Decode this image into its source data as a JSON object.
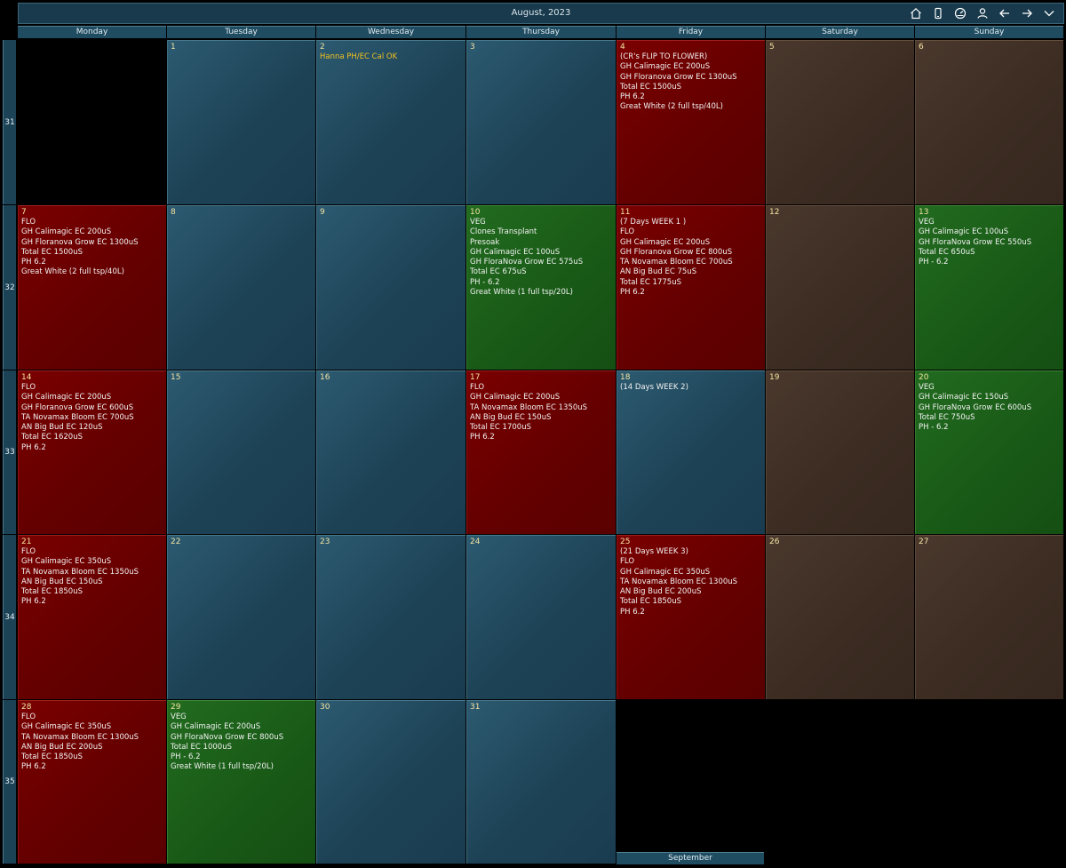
{
  "header": {
    "title": "August, 2023",
    "tools": [
      {
        "name": "home-icon"
      },
      {
        "name": "phone-icon"
      },
      {
        "name": "gauge-icon"
      },
      {
        "name": "user-icon"
      },
      {
        "name": "arrow-left-icon"
      },
      {
        "name": "arrow-right-icon"
      },
      {
        "name": "chevron-down-icon"
      }
    ]
  },
  "days": [
    "Monday",
    "Tuesday",
    "Wednesday",
    "Thursday",
    "Friday",
    "Saturday",
    "Sunday"
  ],
  "weeks": [
    "31",
    "32",
    "33",
    "34",
    "35"
  ],
  "cells": [
    {
      "type": "blank"
    },
    {
      "day": "1",
      "type": "month",
      "lines": []
    },
    {
      "day": "2",
      "type": "month",
      "lines": [],
      "note": "Hanna PH/EC Cal OK"
    },
    {
      "day": "3",
      "type": "month",
      "lines": []
    },
    {
      "day": "4",
      "type": "flo",
      "lines": [
        "(CR's FLIP TO FLOWER)",
        "GH Calimagic EC 200uS",
        "GH Floranova Grow EC 1300uS",
        "Total EC 1500uS",
        "PH 6.2",
        "Great White (2 full tsp/40L)"
      ]
    },
    {
      "day": "5",
      "type": "weekend",
      "lines": []
    },
    {
      "day": "6",
      "type": "weekend",
      "lines": []
    },
    {
      "day": "7",
      "type": "flo",
      "lines": [
        "FLO",
        "GH Calimagic EC 200uS",
        "GH Floranova Grow EC 1300uS",
        "Total EC 1500uS",
        "PH 6.2",
        "Great White (2 full tsp/40L)"
      ]
    },
    {
      "day": "8",
      "type": "month",
      "lines": []
    },
    {
      "day": "9",
      "type": "month",
      "lines": []
    },
    {
      "day": "10",
      "type": "veg",
      "lines": [
        "VEG",
        "Clones Transplant",
        "Presoak",
        "GH Calimagic EC 100uS",
        "GH FloraNova Grow EC 575uS",
        "Total EC 675uS",
        "PH - 6.2",
        "Great White (1 full tsp/20L)"
      ]
    },
    {
      "day": "11",
      "type": "flo",
      "lines": [
        "(7 Days WEEK 1 )",
        "FLO",
        "GH Calimagic EC 200uS",
        "GH Floranova Grow EC 800uS",
        "TA Novamax Bloom EC 700uS",
        "AN Big Bud EC 75uS",
        "Total EC 1775uS",
        "PH 6.2"
      ]
    },
    {
      "day": "12",
      "type": "weekend",
      "lines": []
    },
    {
      "day": "13",
      "type": "veg",
      "lines": [
        "VEG",
        "GH Calimagic EC 100uS",
        "GH FloraNova Grow EC 550uS",
        "Total EC 650uS",
        "PH - 6.2"
      ]
    },
    {
      "day": "14",
      "type": "flo",
      "lines": [
        "FLO",
        "GH Calimagic EC 200uS",
        "GH Floranova Grow EC 600uS",
        "TA Novamax Bloom EC 700uS",
        "AN Big Bud EC 120uS",
        "Total EC 1620uS",
        "PH 6.2"
      ]
    },
    {
      "day": "15",
      "type": "month",
      "lines": []
    },
    {
      "day": "16",
      "type": "month",
      "lines": []
    },
    {
      "day": "17",
      "type": "flo",
      "lines": [
        "FLO",
        "GH Calimagic EC 200uS",
        "TA Novamax Bloom EC 1350uS",
        "AN Big Bud EC 150uS",
        "Total EC 1700uS",
        "PH 6.2"
      ]
    },
    {
      "day": "18",
      "type": "month",
      "lines": [
        "(14 Days WEEK 2)"
      ]
    },
    {
      "day": "19",
      "type": "weekend",
      "lines": []
    },
    {
      "day": "20",
      "type": "veg",
      "lines": [
        "VEG",
        "GH Calimagic EC 150uS",
        "GH FloraNova Grow EC 600uS",
        "Total EC 750uS",
        "PH - 6.2"
      ]
    },
    {
      "day": "21",
      "type": "flo",
      "lines": [
        "FLO",
        "GH Calimagic EC 350uS",
        "TA Novamax Bloom EC 1350uS",
        "AN Big Bud EC 150uS",
        "Total EC 1850uS",
        "PH 6.2"
      ]
    },
    {
      "day": "22",
      "type": "month",
      "lines": []
    },
    {
      "day": "23",
      "type": "month",
      "lines": []
    },
    {
      "day": "24",
      "type": "month",
      "lines": []
    },
    {
      "day": "25",
      "type": "flo",
      "lines": [
        "(21 Days WEEK 3)",
        "FLO",
        "GH Calimagic EC 350uS",
        "TA Novamax Bloom EC 1300uS",
        "AN Big Bud EC 200uS",
        "Total EC 1850uS",
        "PH 6.2"
      ]
    },
    {
      "day": "26",
      "type": "weekend",
      "lines": []
    },
    {
      "day": "27",
      "type": "weekend",
      "lines": []
    },
    {
      "day": "28",
      "type": "flo",
      "lines": [
        "FLO",
        "GH Calimagic EC 350uS",
        "TA Novamax Bloom EC 1300uS",
        "AN Big Bud EC 200uS",
        "Total EC 1850uS",
        "PH 6.2"
      ]
    },
    {
      "day": "29",
      "type": "veg",
      "lines": [
        "VEG",
        "GH Calimagic EC 200uS",
        "GH FloraNova Grow EC 800uS",
        "Total EC 1000uS",
        "PH - 6.2",
        "Great White (1 full tsp/20L)"
      ]
    },
    {
      "day": "30",
      "type": "month",
      "lines": []
    },
    {
      "day": "31",
      "type": "month",
      "lines": []
    },
    {
      "type": "blank"
    },
    {
      "type": "blank"
    },
    {
      "type": "blank"
    }
  ],
  "next_month": "September",
  "colors": {
    "flo": "#640000",
    "veg": "#195a17",
    "month": "#1d4256",
    "weekend": "#3c2c22",
    "note": "#f0c020"
  }
}
